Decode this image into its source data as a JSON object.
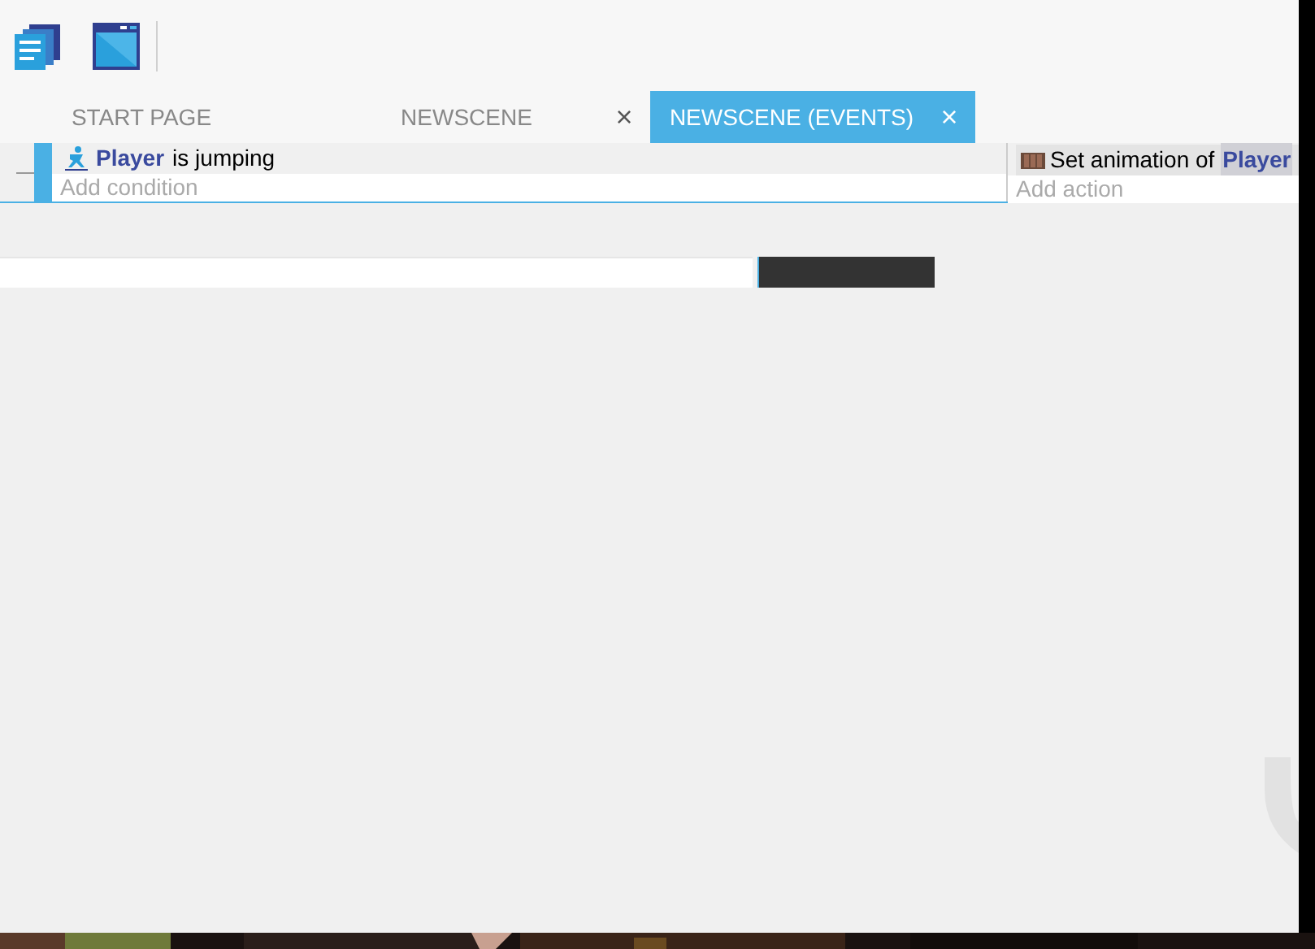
{
  "tabs": [
    {
      "label": "START PAGE",
      "selected": false,
      "closable": false
    },
    {
      "label": "NEWSCENE",
      "selected": false,
      "closable": true
    },
    {
      "label": "NEWSCENE (EVENTS)",
      "selected": true,
      "closable": true
    }
  ],
  "close_glyph": "×",
  "events": [
    {
      "conditions": [
        {
          "text": "is jumping",
          "object": "Player"
        }
      ],
      "add_condition": "Add condition",
      "actions": [
        {
          "text": "Set animation of",
          "object": "Player"
        }
      ],
      "add_action": "Add action"
    }
  ]
}
